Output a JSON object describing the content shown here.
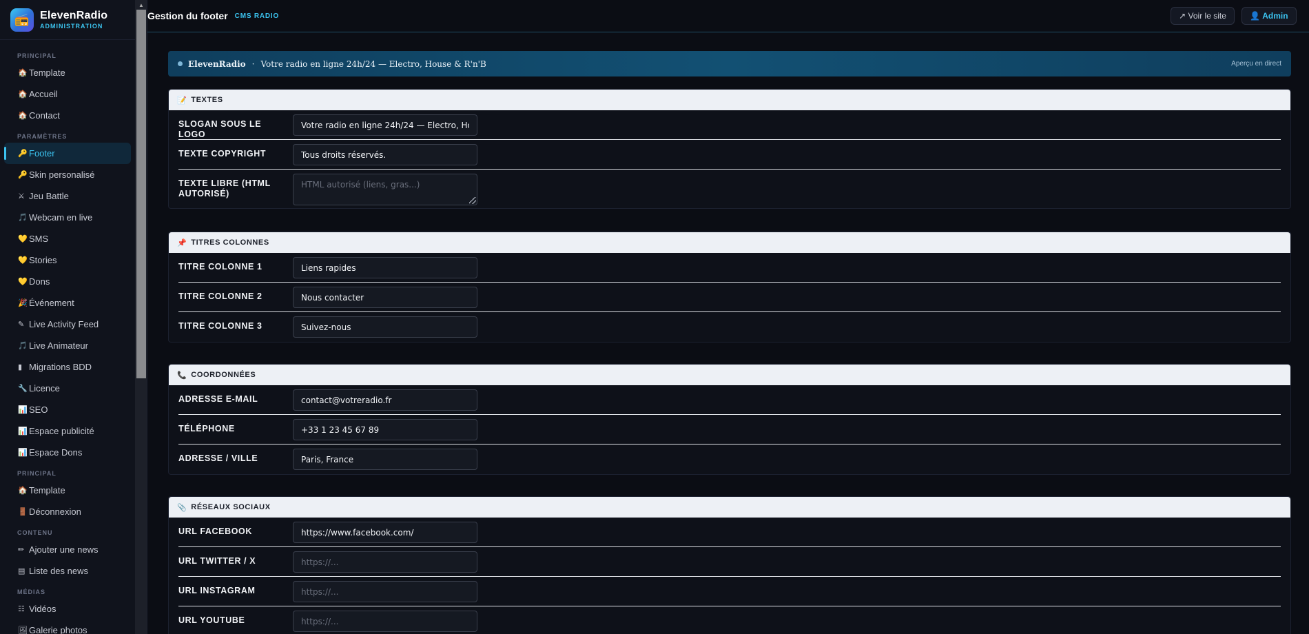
{
  "brand": {
    "title": "ElevenRadio",
    "subtitle": "ADMINISTRATION",
    "logo_icon": "radio-icon"
  },
  "sidebar": {
    "sections": [
      {
        "label": "PRINCIPAL",
        "items": [
          {
            "icon": "🏠",
            "label": "Template"
          },
          {
            "icon": "🏠",
            "label": "Accueil"
          },
          {
            "icon": "🏠",
            "label": "Contact"
          }
        ]
      },
      {
        "label": "PARAMÈTRES",
        "items": [
          {
            "icon": "🔑",
            "label": "Footer",
            "active": true
          },
          {
            "icon": "🔑",
            "label": "Skin personalisé"
          },
          {
            "icon": "⚔",
            "label": "Jeu Battle"
          },
          {
            "icon": "🎵",
            "label": "Webcam en live"
          },
          {
            "icon": "💛",
            "label": "SMS"
          },
          {
            "icon": "💛",
            "label": "Stories"
          },
          {
            "icon": "💛",
            "label": "Dons"
          },
          {
            "icon": "🎉",
            "label": "Événement"
          },
          {
            "icon": "✎",
            "label": "Live Activity Feed"
          },
          {
            "icon": "🎵",
            "label": "Live Animateur"
          },
          {
            "icon": "▮",
            "label": "Migrations BDD"
          },
          {
            "icon": "🔧",
            "label": "Licence"
          },
          {
            "icon": "📊",
            "label": "SEO"
          },
          {
            "icon": "📊",
            "label": "Espace publicité"
          },
          {
            "icon": "📊",
            "label": "Espace Dons"
          }
        ]
      },
      {
        "label": "PRINCIPAL",
        "items": [
          {
            "icon": "🏠",
            "label": "Template"
          },
          {
            "icon": "🚪",
            "label": "Déconnexion"
          }
        ]
      },
      {
        "label": "CONTENU",
        "items": [
          {
            "icon": "✏",
            "label": "Ajouter une news"
          },
          {
            "icon": "▤",
            "label": "Liste des news"
          }
        ]
      },
      {
        "label": "MÉDIAS",
        "items": [
          {
            "icon": "☷",
            "label": "Vidéos"
          },
          {
            "icon": "🖼",
            "label": "Galerie photos"
          }
        ]
      }
    ]
  },
  "header": {
    "title": "Gestion du footer",
    "badge": "CMS RADIO",
    "view_site": "↗ Voir le site",
    "admin": "👤 Admin"
  },
  "preview": {
    "name": "ElevenRadio",
    "separator": "·",
    "slogan": "Votre radio en ligne 24h/24 — Electro, House & R'n'B",
    "live": "Aperçu en direct"
  },
  "textes": {
    "title": "TEXTES",
    "icon": "📝",
    "slogan_label": "SLOGAN SOUS LE LOGO",
    "slogan_value": "Votre radio en ligne 24h/24 — Electro, House & R'n'B",
    "copyright_label": "TEXTE COPYRIGHT",
    "copyright_value": "Tous droits réservés.",
    "libre_label": "TEXTE LIBRE (HTML AUTORISÉ)",
    "libre_placeholder": "HTML autorisé (liens, gras...)"
  },
  "colonnes": {
    "title": "TITRES COLONNES",
    "icon": "📌",
    "col1_label": "TITRE COLONNE 1",
    "col1_value": "Liens rapides",
    "col2_label": "TITRE COLONNE 2",
    "col2_value": "Nous contacter",
    "col3_label": "TITRE COLONNE 3",
    "col3_value": "Suivez-nous"
  },
  "coordonnees": {
    "title": "COORDONNÉES",
    "icon": "📞",
    "email_label": "ADRESSE E-MAIL",
    "email_value": "contact@votreradio.fr",
    "phone_label": "TÉLÉPHONE",
    "phone_value": "+33 1 23 45 67 89",
    "address_label": "ADRESSE / VILLE",
    "address_value": "Paris, France"
  },
  "reseaux": {
    "title": "RÉSEAUX SOCIAUX",
    "icon": "📎",
    "facebook_label": "URL FACEBOOK",
    "facebook_value": "https://www.facebook.com/",
    "twitter_label": "URL TWITTER / X",
    "instagram_label": "URL INSTAGRAM",
    "youtube_label": "URL YOUTUBE",
    "url_placeholder": "https://..."
  }
}
